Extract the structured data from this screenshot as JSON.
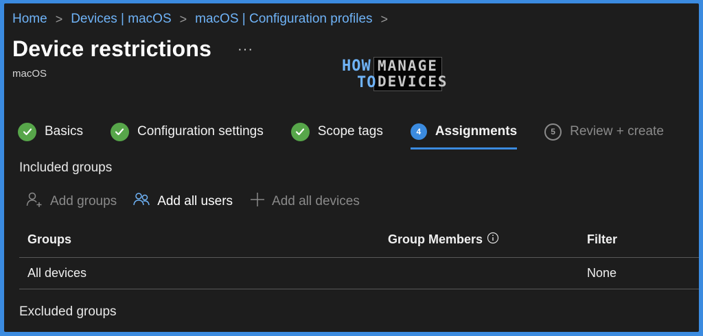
{
  "breadcrumb": {
    "items": [
      "Home",
      "Devices | macOS",
      "macOS | Configuration profiles"
    ],
    "separator": ">"
  },
  "page": {
    "title": "Device restrictions",
    "subtitle": "macOS",
    "more": "···"
  },
  "logo": {
    "how": "HOW",
    "to": "TO",
    "manage": "MANAGE",
    "devices": "DEVICES"
  },
  "steps": [
    {
      "label": "Basics",
      "state": "complete"
    },
    {
      "label": "Configuration settings",
      "state": "complete"
    },
    {
      "label": "Scope tags",
      "state": "complete"
    },
    {
      "label": "Assignments",
      "state": "active",
      "number": "4"
    },
    {
      "label": "Review + create",
      "state": "disabled",
      "number": "5"
    }
  ],
  "included": {
    "heading": "Included groups",
    "actions": {
      "add_groups": "Add groups",
      "add_all_users": "Add all users",
      "add_all_devices": "Add all devices"
    },
    "columns": [
      "Groups",
      "Group Members",
      "Filter"
    ],
    "rows": [
      {
        "group": "All devices",
        "members": "",
        "filter": "None"
      }
    ]
  },
  "excluded": {
    "heading": "Excluded groups"
  },
  "colors": {
    "accent": "#3b8be0",
    "link": "#6fb3f7",
    "success": "#57a64a",
    "background": "#1d1d1d"
  }
}
